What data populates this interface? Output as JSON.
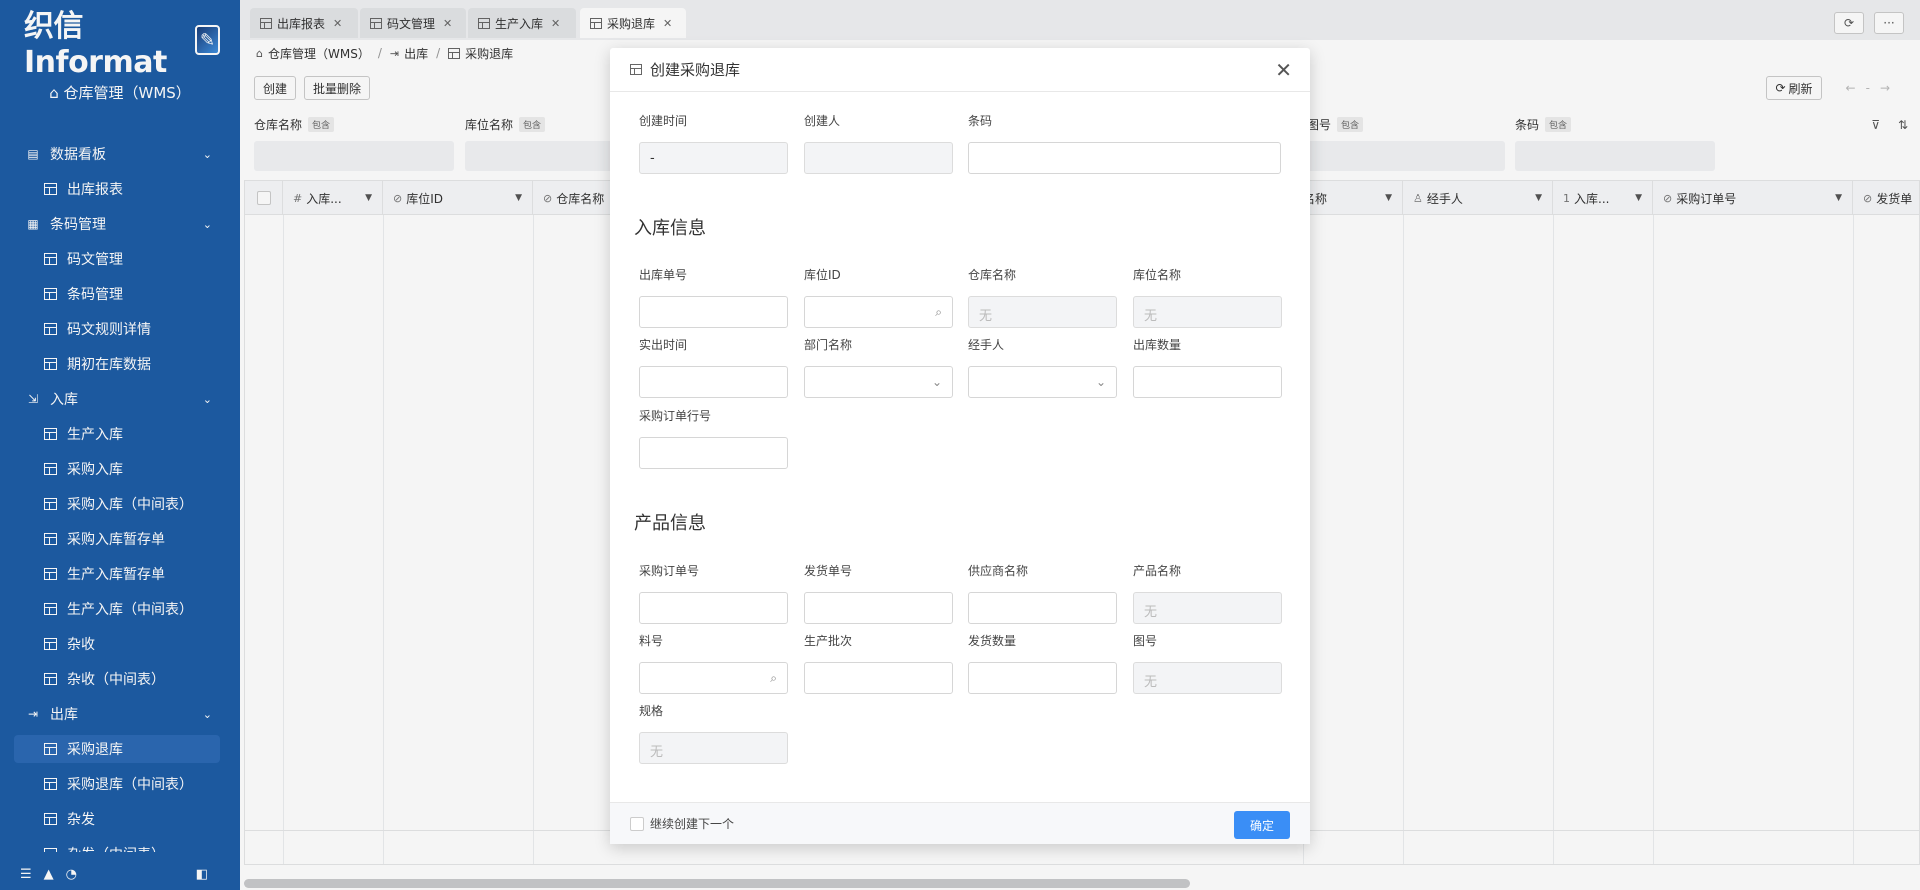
{
  "app": {
    "logo_text": "织信 Informat",
    "app_name": "仓库管理（WMS）"
  },
  "sidebar": {
    "items": [
      {
        "label": "数据看板",
        "type": "group",
        "expanded": true
      },
      {
        "label": "出库报表",
        "type": "child"
      },
      {
        "label": "条码管理",
        "type": "group",
        "expanded": true
      },
      {
        "label": "码文管理",
        "type": "child"
      },
      {
        "label": "条码管理",
        "type": "child"
      },
      {
        "label": "码文规则详情",
        "type": "child"
      },
      {
        "label": "期初在库数据",
        "type": "child"
      },
      {
        "label": "入库",
        "type": "group",
        "expanded": true
      },
      {
        "label": "生产入库",
        "type": "child"
      },
      {
        "label": "采购入库",
        "type": "child"
      },
      {
        "label": "采购入库（中间表）",
        "type": "child"
      },
      {
        "label": "采购入库暂存单",
        "type": "child"
      },
      {
        "label": "生产入库暂存单",
        "type": "child"
      },
      {
        "label": "生产入库（中间表）",
        "type": "child"
      },
      {
        "label": "杂收",
        "type": "child"
      },
      {
        "label": "杂收（中间表）",
        "type": "child"
      },
      {
        "label": "出库",
        "type": "group",
        "expanded": true
      },
      {
        "label": "采购退库",
        "type": "child",
        "active": true
      },
      {
        "label": "采购退库（中间表）",
        "type": "child"
      },
      {
        "label": "杂发",
        "type": "child"
      },
      {
        "label": "杂发（中间表）",
        "type": "child"
      }
    ],
    "footer_icons": [
      "menu-icon",
      "bell-warning-icon",
      "notification-icon",
      "sidebar-toggle-icon"
    ]
  },
  "tabs": [
    {
      "label": "出库报表",
      "active": false
    },
    {
      "label": "码文管理",
      "active": false
    },
    {
      "label": "生产入库",
      "active": false
    },
    {
      "label": "采购退库",
      "active": true
    }
  ],
  "breadcrumb": [
    "仓库管理（WMS）",
    "出库",
    "采购退库"
  ],
  "toolbar": {
    "create": "创建",
    "batch_delete": "批量删除",
    "refresh": "刷新",
    "page": "-"
  },
  "filters": [
    {
      "label": "仓库名称",
      "mode": "包含"
    },
    {
      "label": "库位名称",
      "mode": "包含"
    },
    {
      "label": "图号",
      "mode": "包含"
    },
    {
      "label": "条码",
      "mode": "包含"
    }
  ],
  "grid": {
    "columns": [
      {
        "label": "入库...",
        "prefix": "#"
      },
      {
        "label": "库位ID",
        "prefix": "⊘"
      },
      {
        "label": "仓库名称",
        "prefix": "⊘"
      },
      {
        "label": "名称",
        "prefix": ""
      },
      {
        "label": "经手人",
        "prefix": "♙"
      },
      {
        "label": "入库...",
        "prefix": "1"
      },
      {
        "label": "采购订单号",
        "prefix": "⊘"
      },
      {
        "label": "发货单",
        "prefix": "⊘"
      }
    ]
  },
  "modal": {
    "title": "创建采购退库",
    "top_fields": {
      "created_time": {
        "label": "创建时间",
        "value": "-"
      },
      "creator": {
        "label": "创建人",
        "value": ""
      },
      "barcode": {
        "label": "条码",
        "value": ""
      }
    },
    "section_inbound": "入库信息",
    "inbound": {
      "out_no": {
        "label": "出库单号"
      },
      "location_id": {
        "label": "库位ID"
      },
      "warehouse_name": {
        "label": "仓库名称",
        "value": "无"
      },
      "location_name": {
        "label": "库位名称",
        "value": "无"
      },
      "actual_time": {
        "label": "实出时间"
      },
      "dept_name": {
        "label": "部门名称"
      },
      "handler": {
        "label": "经手人"
      },
      "out_qty": {
        "label": "出库数量"
      },
      "po_line": {
        "label": "采购订单行号"
      }
    },
    "section_product": "产品信息",
    "product": {
      "po_no": {
        "label": "采购订单号"
      },
      "ship_no": {
        "label": "发货单号"
      },
      "supplier": {
        "label": "供应商名称"
      },
      "product_name": {
        "label": "产品名称",
        "value": "无"
      },
      "item_no": {
        "label": "料号"
      },
      "batch": {
        "label": "生产批次"
      },
      "ship_qty": {
        "label": "发货数量"
      },
      "drawing_no": {
        "label": "图号",
        "value": "无"
      },
      "spec": {
        "label": "规格",
        "value": "无"
      }
    },
    "continue_label": "继续创建下一个",
    "confirm": "确定"
  },
  "colors": {
    "sidebar_bg": "#1e5da6",
    "primary": "#3a8ef6"
  }
}
